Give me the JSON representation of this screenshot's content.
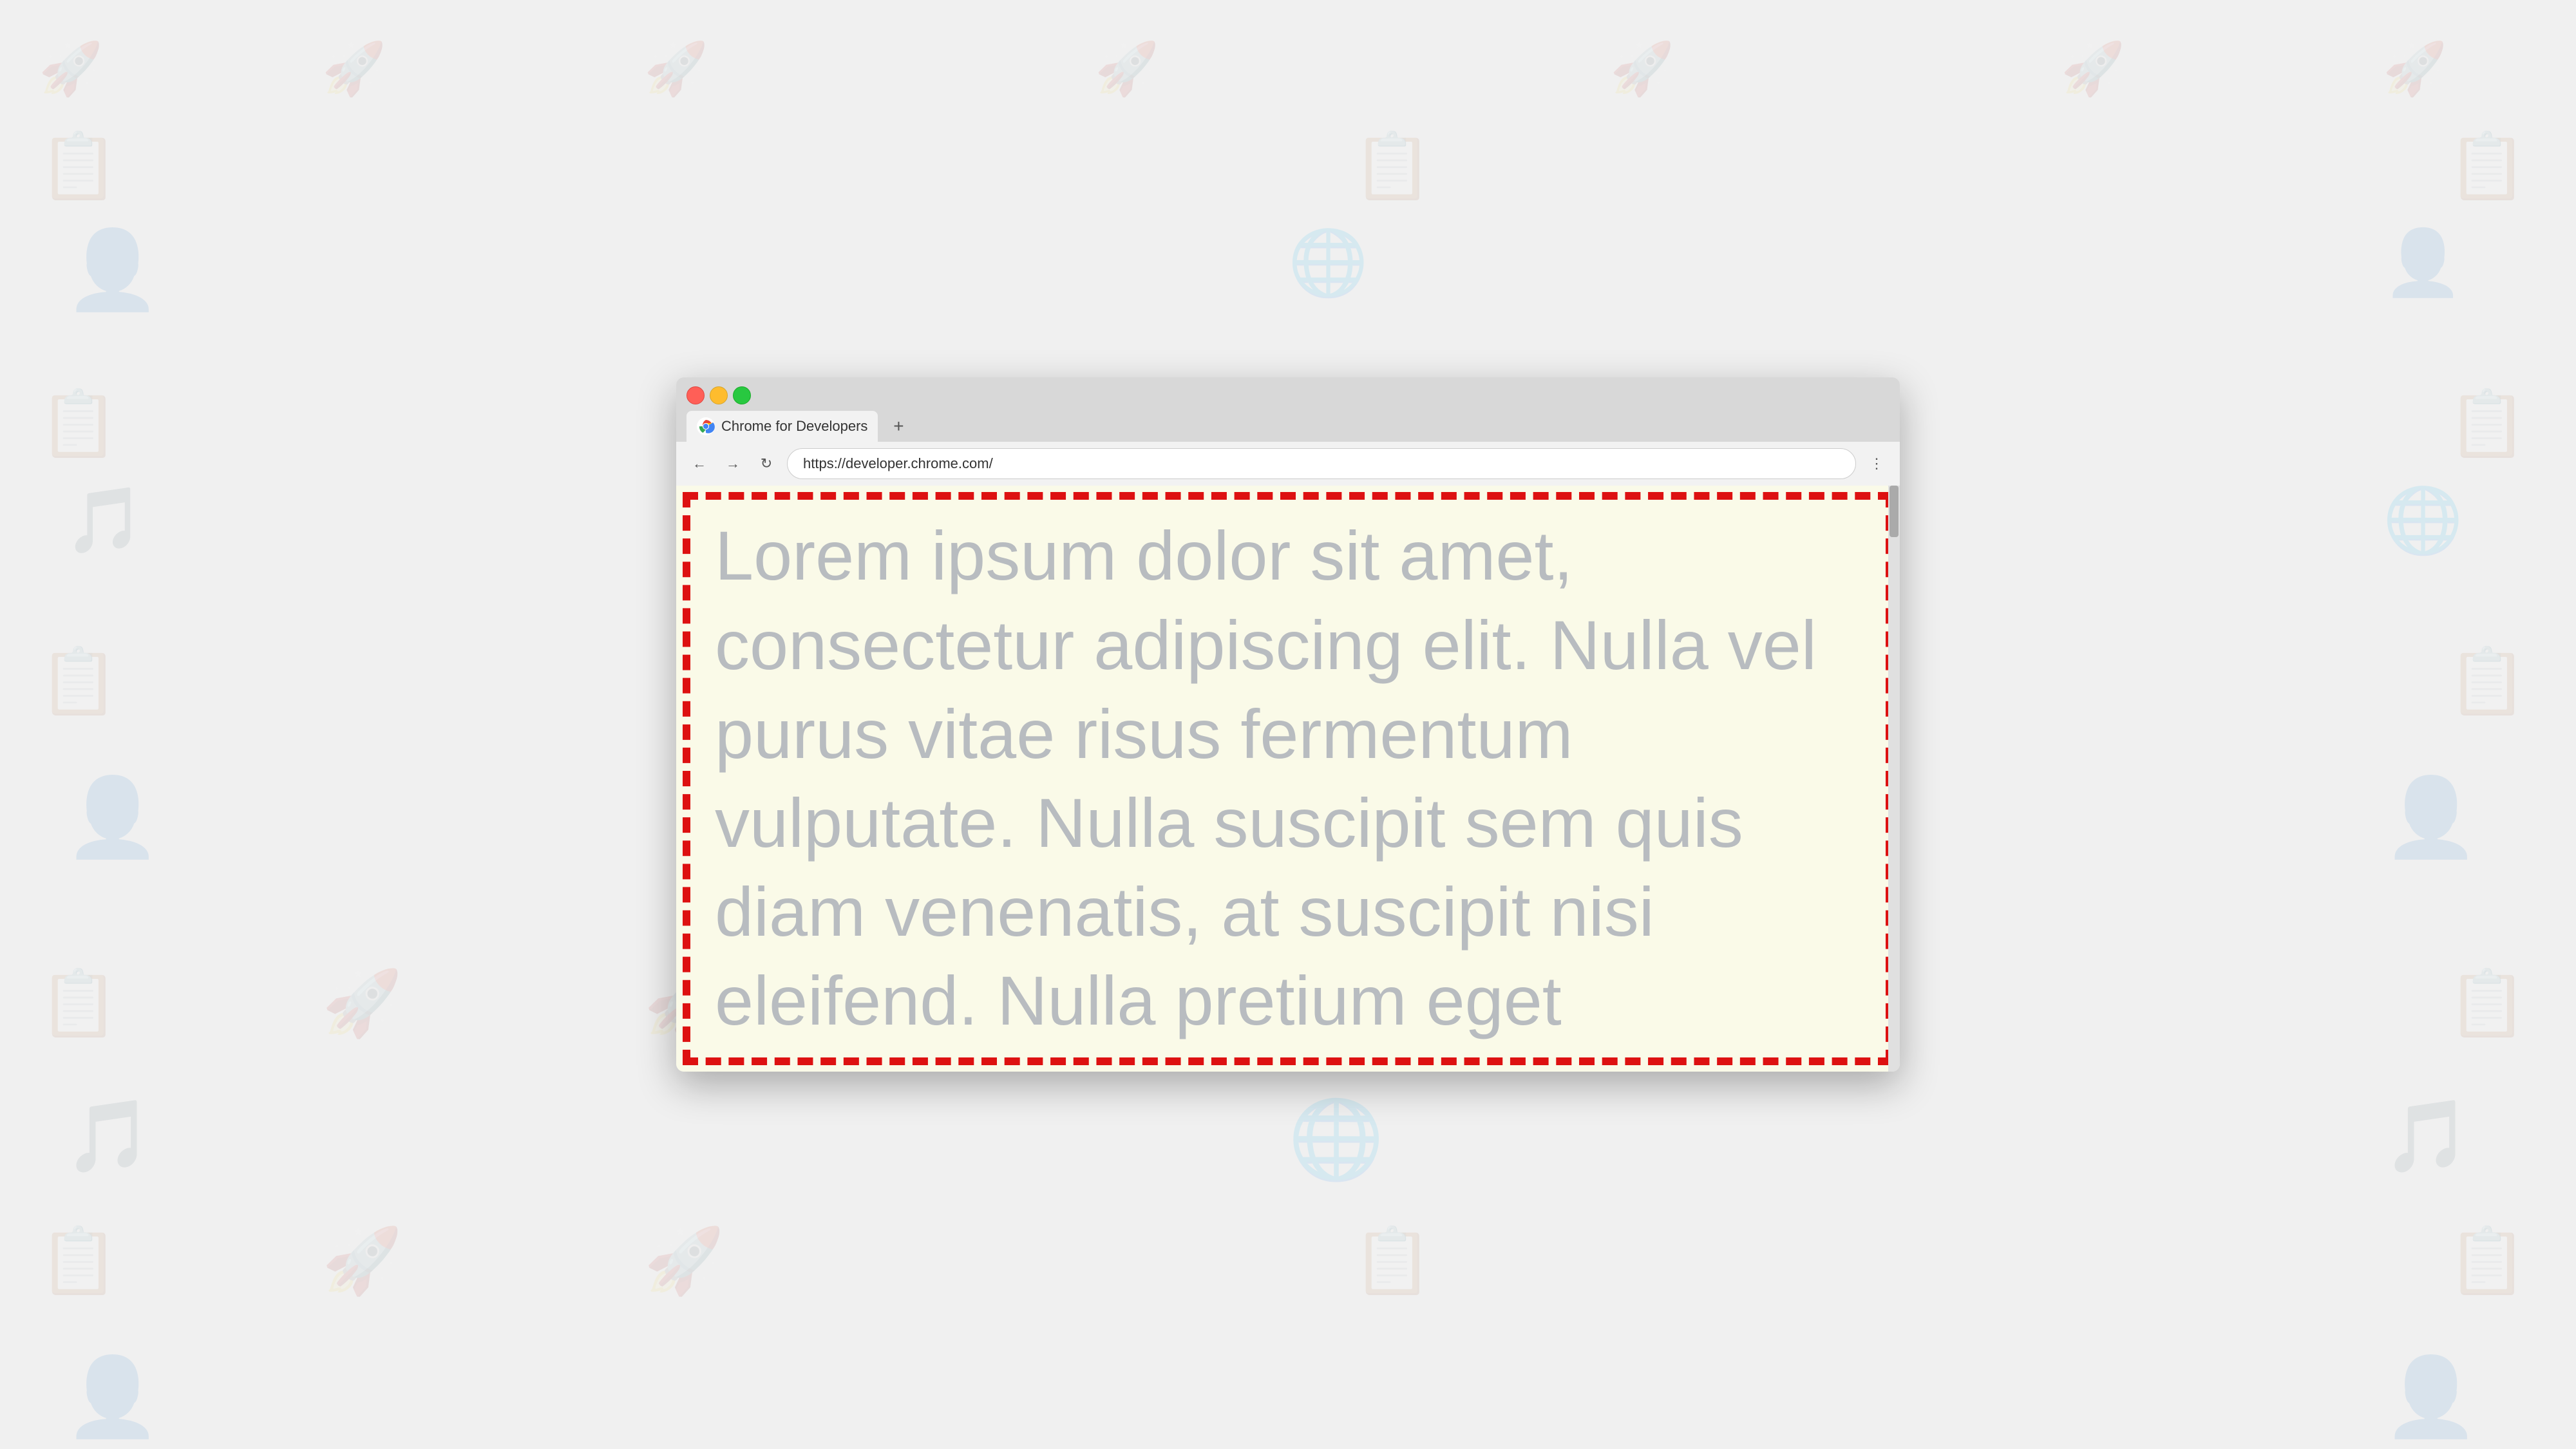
{
  "background": {
    "color": "#f0f0f0"
  },
  "browser": {
    "tab": {
      "title": "Chrome for Developers",
      "favicon_alt": "Chrome logo"
    },
    "new_tab_label": "+",
    "address_bar": {
      "url": "https://developer.chrome.com/"
    },
    "menu_icon": "⋮",
    "nav": {
      "back_icon": "←",
      "forward_icon": "→",
      "refresh_icon": "↻"
    }
  },
  "webpage": {
    "lorem_text": "Lorem ipsum dolor sit amet, consectetur adipiscing elit. Nulla vel purus vitae risus fermentum vulputate. Nulla suscipit sem quis diam venenatis, at suscipit nisi eleifend. Nulla pretium eget",
    "background_color": "#fafae8",
    "border_color": "#dd1111"
  }
}
